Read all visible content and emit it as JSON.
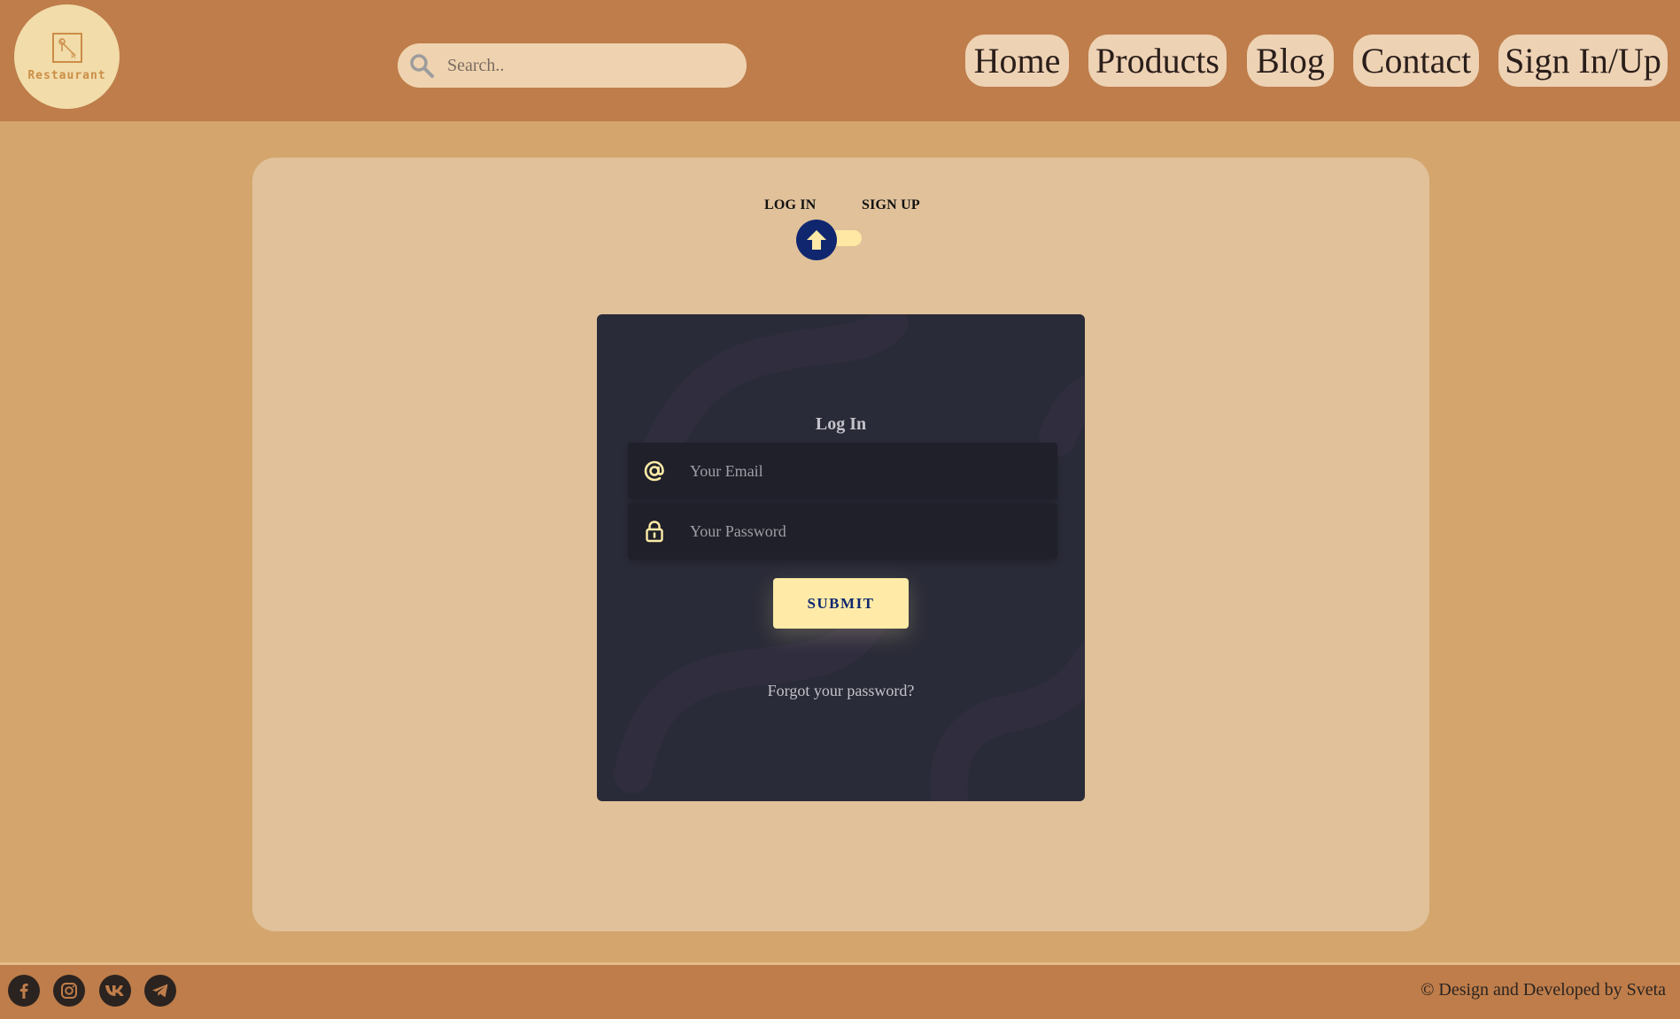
{
  "header": {
    "logo_text": "Restaurant",
    "search_placeholder": "Search..",
    "nav": [
      "Home",
      "Products",
      "Blog",
      "Contact",
      "Sign In/Up"
    ]
  },
  "auth": {
    "toggle_labels": [
      "LOG IN",
      "SIGN UP"
    ],
    "card_title": "Log In",
    "email_placeholder": "Your Email",
    "password_placeholder": "Your Password",
    "submit_label": "SUBMIT",
    "forgot_link": "Forgot your password?"
  },
  "footer": {
    "social_icons": [
      "facebook-icon",
      "instagram-icon",
      "vk-icon",
      "telegram-icon"
    ],
    "credit": "© Design and Developed by Sveta"
  },
  "colors": {
    "header_bg": "#be7d4a",
    "page_bg": "#d4a66d",
    "panel_bg": "#e0c19a",
    "card_bg": "#2a2b38",
    "field_bg": "#1f2029",
    "accent_yellow": "#ffeba7",
    "accent_navy": "#102770"
  }
}
